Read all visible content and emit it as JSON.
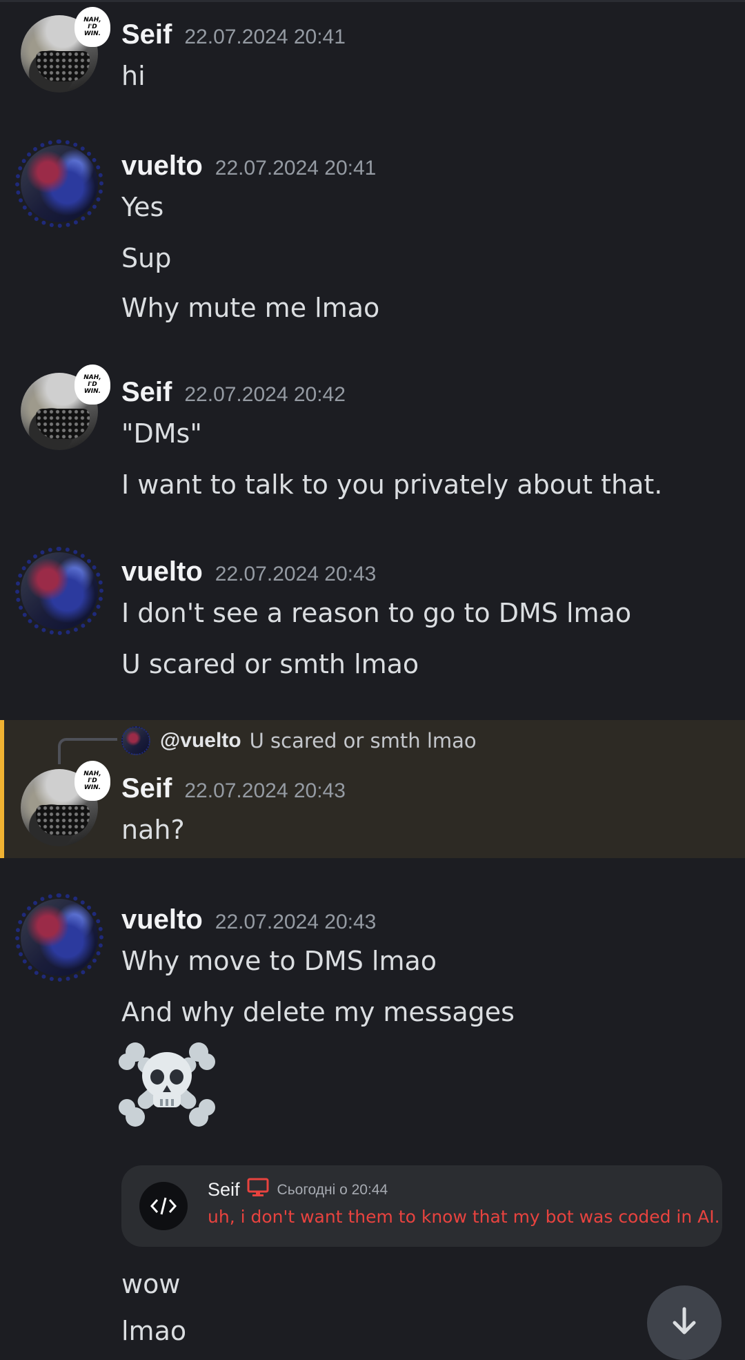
{
  "messages": [
    {
      "username": "Seif",
      "timestamp": "22.07.2024 20:41",
      "avatar_badge": [
        "NAH,",
        "I'D",
        "WIN."
      ],
      "lines": [
        "hi"
      ]
    },
    {
      "username": "vuelto",
      "timestamp": "22.07.2024 20:41",
      "lines": [
        "Yes",
        "Sup",
        "Why mute me lmao"
      ]
    },
    {
      "username": "Seif",
      "timestamp": "22.07.2024 20:42",
      "avatar_badge": [
        "NAH,",
        "I'D",
        "WIN."
      ],
      "lines": [
        "\"DMs\"",
        "I want to talk to you privately about that."
      ]
    },
    {
      "username": "vuelto",
      "timestamp": "22.07.2024 20:43",
      "lines": [
        "I don't see a reason to go to DMS lmao",
        "U scared or smth lmao"
      ]
    },
    {
      "username": "Seif",
      "timestamp": "22.07.2024 20:43",
      "avatar_badge": [
        "NAH,",
        "I'D",
        "WIN."
      ],
      "reply": {
        "mention": "@vuelto",
        "text": "U scared or smth lmao"
      },
      "lines": [
        "nah?"
      ]
    },
    {
      "username": "vuelto",
      "timestamp": "22.07.2024 20:43",
      "lines": [
        "Why move to DMS lmao",
        "And why delete my messages"
      ],
      "emoji": "skull-and-crossbones",
      "embed": {
        "icon": "code-icon",
        "username": "Seif",
        "badge_icon": "monitor-icon",
        "time": "Сьогодні о 20:44",
        "text": "uh, i don't want them to know that my bot was coded in AI."
      },
      "after_lines": [
        "wow",
        "lmao"
      ]
    }
  ],
  "scroll_button_icon": "arrow-down-icon",
  "colors": {
    "background": "#1c1d22",
    "highlight_background": "#2d2a24",
    "highlight_bar": "#f0b232",
    "embed_text": "#e8433f",
    "timestamp": "#959ba3"
  }
}
